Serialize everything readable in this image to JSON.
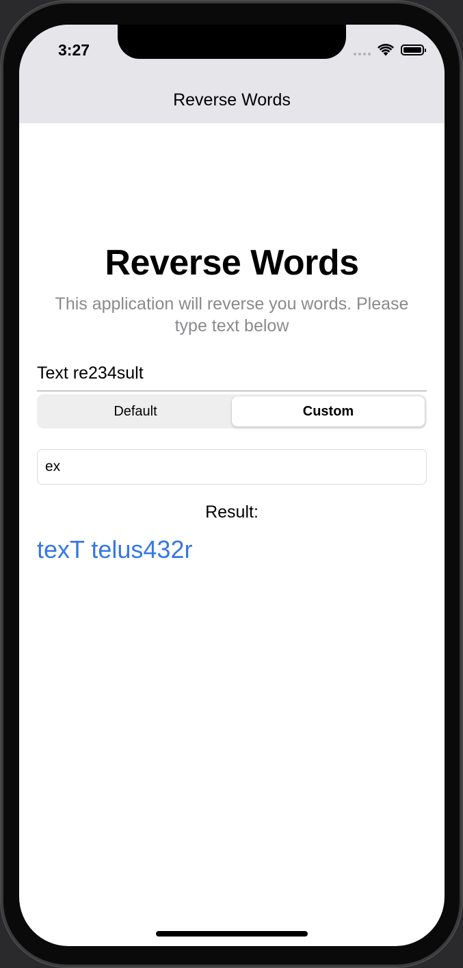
{
  "status_bar": {
    "time": "3:27",
    "icons": [
      "cellular-signal-icon",
      "wifi-icon",
      "battery-icon"
    ]
  },
  "nav": {
    "title": "Reverse Words"
  },
  "main": {
    "heading": "Reverse Words",
    "subtitle": "This application will reverse you words. Please type text below",
    "text_field_value": "Text re234sult",
    "segments": [
      {
        "label": "Default",
        "selected": false
      },
      {
        "label": "Custom",
        "selected": true
      }
    ],
    "custom_input_value": "ex",
    "result_label": "Result:",
    "result_value": "texT telus432r"
  },
  "colors": {
    "accent": "#3478e6",
    "nav_background": "#e5e5ea",
    "subtitle": "#8a8a8e"
  }
}
